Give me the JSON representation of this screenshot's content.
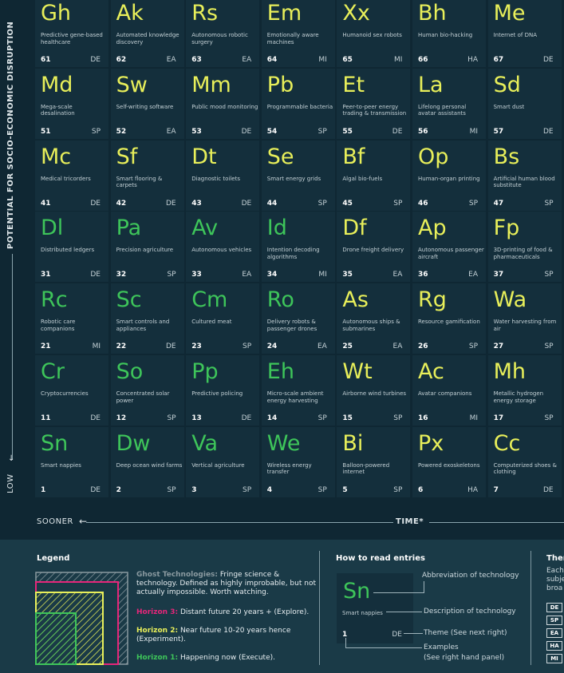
{
  "axes": {
    "y_title": "POTENTIAL FOR SOCIO-ECONOMIC DISRUPTION",
    "y_low": "LOW",
    "x_sooner": "SOONER",
    "x_time": "TIME*"
  },
  "colors": {
    "horizon1": "#3ec55a",
    "horizon2": "#e8ef5a",
    "horizon3": "#e6267a",
    "ghost": "#8a9aa0",
    "tile": "#142f3c",
    "background": "#0f2733"
  },
  "rows": [
    [
      {
        "sym": "Gh",
        "desc": "Predictive gene-based healthcare",
        "num": "61",
        "theme": "DE",
        "horizon": 2
      },
      {
        "sym": "Ak",
        "desc": "Automated knowledge discovery",
        "num": "62",
        "theme": "EA",
        "horizon": 2
      },
      {
        "sym": "Rs",
        "desc": "Autonomous robotic surgery",
        "num": "63",
        "theme": "EA",
        "horizon": 2
      },
      {
        "sym": "Em",
        "desc": "Emotionally aware machines",
        "num": "64",
        "theme": "MI",
        "horizon": 2
      },
      {
        "sym": "Xx",
        "desc": "Humanoid sex robots",
        "num": "65",
        "theme": "MI",
        "horizon": 2
      },
      {
        "sym": "Bh",
        "desc": "Human bio-hacking",
        "num": "66",
        "theme": "HA",
        "horizon": 2
      },
      {
        "sym": "Me",
        "desc": "Internet of DNA",
        "num": "67",
        "theme": "DE",
        "horizon": 2
      }
    ],
    [
      {
        "sym": "Md",
        "desc": "Mega-scale desalination",
        "num": "51",
        "theme": "SP",
        "horizon": 2
      },
      {
        "sym": "Sw",
        "desc": "Self-writing software",
        "num": "52",
        "theme": "EA",
        "horizon": 2
      },
      {
        "sym": "Mm",
        "desc": "Public mood monitoring",
        "num": "53",
        "theme": "DE",
        "horizon": 2
      },
      {
        "sym": "Pb",
        "desc": "Programmable bacteria",
        "num": "54",
        "theme": "SP",
        "horizon": 2
      },
      {
        "sym": "Et",
        "desc": "Peer-to-peer energy trading & transmission",
        "num": "55",
        "theme": "DE",
        "horizon": 2
      },
      {
        "sym": "La",
        "desc": "Lifelong personal avatar assistants",
        "num": "56",
        "theme": "MI",
        "horizon": 2
      },
      {
        "sym": "Sd",
        "desc": "Smart dust",
        "num": "57",
        "theme": "DE",
        "horizon": 2
      }
    ],
    [
      {
        "sym": "Mc",
        "desc": "Medical tricorders",
        "num": "41",
        "theme": "DE",
        "horizon": 2
      },
      {
        "sym": "Sf",
        "desc": "Smart flooring & carpets",
        "num": "42",
        "theme": "DE",
        "horizon": 2
      },
      {
        "sym": "Dt",
        "desc": "Diagnostic toilets",
        "num": "43",
        "theme": "DE",
        "horizon": 2
      },
      {
        "sym": "Se",
        "desc": "Smart energy grids",
        "num": "44",
        "theme": "SP",
        "horizon": 2
      },
      {
        "sym": "Bf",
        "desc": "Algal bio-fuels",
        "num": "45",
        "theme": "SP",
        "horizon": 2
      },
      {
        "sym": "Op",
        "desc": "Human-organ printing",
        "num": "46",
        "theme": "SP",
        "horizon": 2
      },
      {
        "sym": "Bs",
        "desc": "Artificial human blood substitute",
        "num": "47",
        "theme": "SP",
        "horizon": 2
      }
    ],
    [
      {
        "sym": "Dl",
        "desc": "Distributed ledgers",
        "num": "31",
        "theme": "DE",
        "horizon": 1
      },
      {
        "sym": "Pa",
        "desc": "Precision agriculture",
        "num": "32",
        "theme": "SP",
        "horizon": 1
      },
      {
        "sym": "Av",
        "desc": "Autonomous vehicles",
        "num": "33",
        "theme": "EA",
        "horizon": 1
      },
      {
        "sym": "Id",
        "desc": "Intention decoding algorithms",
        "num": "34",
        "theme": "MI",
        "horizon": 1
      },
      {
        "sym": "Df",
        "desc": "Drone freight delivery",
        "num": "35",
        "theme": "EA",
        "horizon": 2
      },
      {
        "sym": "Ap",
        "desc": "Autonomous passenger aircraft",
        "num": "36",
        "theme": "EA",
        "horizon": 2
      },
      {
        "sym": "Fp",
        "desc": "3D-printing of food & pharmaceuticals",
        "num": "37",
        "theme": "SP",
        "horizon": 2
      }
    ],
    [
      {
        "sym": "Rc",
        "desc": "Robotic care companions",
        "num": "21",
        "theme": "MI",
        "horizon": 1
      },
      {
        "sym": "Sc",
        "desc": "Smart controls and appliances",
        "num": "22",
        "theme": "DE",
        "horizon": 1
      },
      {
        "sym": "Cm",
        "desc": "Cultured meat",
        "num": "23",
        "theme": "SP",
        "horizon": 1
      },
      {
        "sym": "Ro",
        "desc": "Delivery robots & passenger drones",
        "num": "24",
        "theme": "EA",
        "horizon": 1
      },
      {
        "sym": "As",
        "desc": "Autonomous ships & submarines",
        "num": "25",
        "theme": "EA",
        "horizon": 2
      },
      {
        "sym": "Rg",
        "desc": "Resource gamification",
        "num": "26",
        "theme": "SP",
        "horizon": 2
      },
      {
        "sym": "Wa",
        "desc": "Water harvesting from air",
        "num": "27",
        "theme": "SP",
        "horizon": 2
      }
    ],
    [
      {
        "sym": "Cr",
        "desc": "Cryptocurrencies",
        "num": "11",
        "theme": "DE",
        "horizon": 1
      },
      {
        "sym": "So",
        "desc": "Concentrated solar power",
        "num": "12",
        "theme": "SP",
        "horizon": 1
      },
      {
        "sym": "Pp",
        "desc": "Predictive policing",
        "num": "13",
        "theme": "DE",
        "horizon": 1
      },
      {
        "sym": "Eh",
        "desc": "Micro-scale ambient energy harvesting",
        "num": "14",
        "theme": "SP",
        "horizon": 1
      },
      {
        "sym": "Wt",
        "desc": "Airborne wind turbines",
        "num": "15",
        "theme": "SP",
        "horizon": 2
      },
      {
        "sym": "Ac",
        "desc": "Avatar companions",
        "num": "16",
        "theme": "MI",
        "horizon": 2
      },
      {
        "sym": "Mh",
        "desc": "Metallic hydrogen energy storage",
        "num": "17",
        "theme": "SP",
        "horizon": 2
      }
    ],
    [
      {
        "sym": "Sn",
        "desc": "Smart nappies",
        "num": "1",
        "theme": "DE",
        "horizon": 1
      },
      {
        "sym": "Dw",
        "desc": "Deep ocean wind farms",
        "num": "2",
        "theme": "SP",
        "horizon": 1
      },
      {
        "sym": "Va",
        "desc": "Vertical agriculture",
        "num": "3",
        "theme": "SP",
        "horizon": 1
      },
      {
        "sym": "We",
        "desc": "Wireless energy transfer",
        "num": "4",
        "theme": "SP",
        "horizon": 1
      },
      {
        "sym": "Bi",
        "desc": "Balloon-powered internet",
        "num": "5",
        "theme": "SP",
        "horizon": 2
      },
      {
        "sym": "Px",
        "desc": "Powered exoskeletons",
        "num": "6",
        "theme": "HA",
        "horizon": 2
      },
      {
        "sym": "Cc",
        "desc": "Computerized shoes & clothing",
        "num": "7",
        "theme": "DE",
        "horizon": 2
      }
    ]
  ],
  "legend": {
    "title": "Legend",
    "ghost_label": "Ghost Technologies:",
    "ghost_text": "Fringe science & technology. Defined as highly improbable, but not actually impossible. Worth watching.",
    "h3_label": "Horizon 3:",
    "h3_text": "Distant future 20 years + (Explore).",
    "h2_label": "Horizon 2:",
    "h2_text": "Near future 10-20 years hence (Experiment).",
    "h1_label": "Horizon 1:",
    "h1_text": "Happening now (Execute)."
  },
  "howto": {
    "title": "How to read entries",
    "sym": "Sn",
    "desc": "Smart nappies",
    "num": "1",
    "theme": "DE",
    "note_abbr": "Abbreviation of technology",
    "note_desc": "Description of technology",
    "note_theme": "Theme (See next right)",
    "note_examples": "Examples",
    "note_examples2": "(See right hand panel)"
  },
  "themes": {
    "title": "Ther",
    "desc_line1": "Each",
    "desc_line2": "subje",
    "desc_line3": "broa",
    "codes": [
      "DE",
      "SP",
      "EA",
      "HA",
      "MI"
    ]
  }
}
